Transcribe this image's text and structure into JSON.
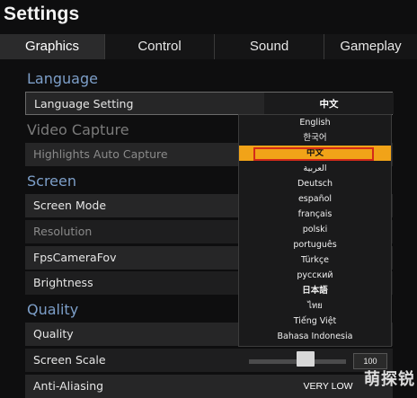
{
  "window": {
    "title": "Settings"
  },
  "tabs": [
    {
      "label": "Graphics"
    },
    {
      "label": "Control"
    },
    {
      "label": "Sound"
    },
    {
      "label": "Gameplay"
    }
  ],
  "sections": {
    "language": "Language",
    "video_capture": "Video Capture",
    "screen": "Screen",
    "quality": "Quality"
  },
  "rows": {
    "language_setting": {
      "label": "Language Setting",
      "value": "中文"
    },
    "highlights_auto_capture": {
      "label": "Highlights Auto Capture"
    },
    "screen_mode": {
      "label": "Screen Mode"
    },
    "resolution": {
      "label": "Resolution"
    },
    "fps_camera_fov": {
      "label": "FpsCameraFov"
    },
    "brightness": {
      "label": "Brightness"
    },
    "quality": {
      "label": "Quality"
    },
    "screen_scale": {
      "label": "Screen Scale",
      "value": "100",
      "level_percent": 60
    },
    "anti_aliasing": {
      "label": "Anti-Aliasing",
      "value": "VERY LOW"
    }
  },
  "language_dropdown": {
    "options": [
      "English",
      "한국어",
      "中文",
      "العربية",
      "Deutsch",
      "español",
      "français",
      "polski",
      "português",
      "Türkçe",
      "русский",
      "日本語",
      "ไทย",
      "Tiếng Việt",
      "Bahasa Indonesia"
    ],
    "selected": "中文"
  },
  "watermark": {
    "text": "萌探锐"
  },
  "colors": {
    "accent_section": "#7d9fc9",
    "selected_option": "#f1a318",
    "selection_outline": "#d32a1a"
  }
}
